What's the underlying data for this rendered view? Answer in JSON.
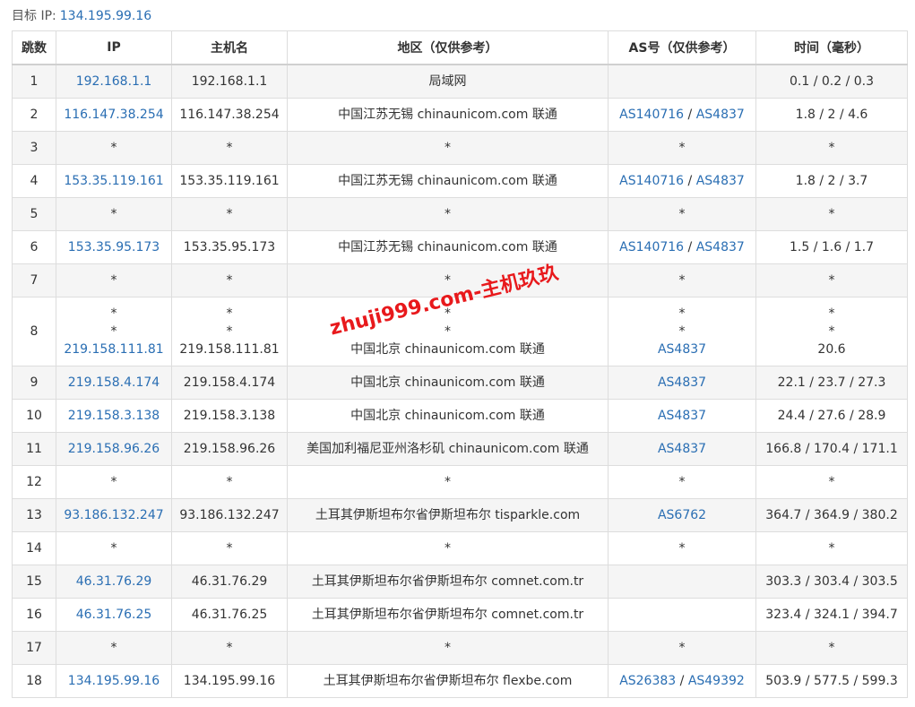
{
  "target": {
    "label": "目标 IP:",
    "ip": "134.195.99.16"
  },
  "columns": [
    "跳数",
    "IP",
    "主机名",
    "地区（仅供参考）",
    "AS号（仅供参考）",
    "时间（毫秒）"
  ],
  "hops": [
    {
      "hop": "1",
      "ip": [
        "192.168.1.1"
      ],
      "host": [
        "192.168.1.1"
      ],
      "region": [
        "局域网"
      ],
      "as": [
        []
      ],
      "time": [
        "0.1 / 0.2 / 0.3"
      ]
    },
    {
      "hop": "2",
      "ip": [
        "116.147.38.254"
      ],
      "host": [
        "116.147.38.254"
      ],
      "region": [
        "中国江苏无锡 chinaunicom.com 联通"
      ],
      "as": [
        [
          "AS140716",
          "AS4837"
        ]
      ],
      "time": [
        "1.8 / 2 / 4.6"
      ]
    },
    {
      "hop": "3",
      "ip": [
        "*"
      ],
      "host": [
        "*"
      ],
      "region": [
        "*"
      ],
      "as": [
        [
          "*"
        ]
      ],
      "time": [
        "*"
      ]
    },
    {
      "hop": "4",
      "ip": [
        "153.35.119.161"
      ],
      "host": [
        "153.35.119.161"
      ],
      "region": [
        "中国江苏无锡 chinaunicom.com 联通"
      ],
      "as": [
        [
          "AS140716",
          "AS4837"
        ]
      ],
      "time": [
        "1.8 / 2 / 3.7"
      ]
    },
    {
      "hop": "5",
      "ip": [
        "*"
      ],
      "host": [
        "*"
      ],
      "region": [
        "*"
      ],
      "as": [
        [
          "*"
        ]
      ],
      "time": [
        "*"
      ]
    },
    {
      "hop": "6",
      "ip": [
        "153.35.95.173"
      ],
      "host": [
        "153.35.95.173"
      ],
      "region": [
        "中国江苏无锡 chinaunicom.com 联通"
      ],
      "as": [
        [
          "AS140716",
          "AS4837"
        ]
      ],
      "time": [
        "1.5 / 1.6 / 1.7"
      ]
    },
    {
      "hop": "7",
      "ip": [
        "*"
      ],
      "host": [
        "*"
      ],
      "region": [
        "*"
      ],
      "as": [
        [
          "*"
        ]
      ],
      "time": [
        "*"
      ]
    },
    {
      "hop": "8",
      "ip": [
        "*",
        "*",
        "219.158.111.81"
      ],
      "host": [
        "*",
        "*",
        "219.158.111.81"
      ],
      "region": [
        "*",
        "*",
        "中国北京 chinaunicom.com 联通"
      ],
      "as": [
        [
          "*"
        ],
        [
          "*"
        ],
        [
          "AS4837"
        ]
      ],
      "time": [
        "*",
        "*",
        "20.6"
      ]
    },
    {
      "hop": "9",
      "ip": [
        "219.158.4.174"
      ],
      "host": [
        "219.158.4.174"
      ],
      "region": [
        "中国北京 chinaunicom.com 联通"
      ],
      "as": [
        [
          "AS4837"
        ]
      ],
      "time": [
        "22.1 / 23.7 / 27.3"
      ]
    },
    {
      "hop": "10",
      "ip": [
        "219.158.3.138"
      ],
      "host": [
        "219.158.3.138"
      ],
      "region": [
        "中国北京 chinaunicom.com 联通"
      ],
      "as": [
        [
          "AS4837"
        ]
      ],
      "time": [
        "24.4 / 27.6 / 28.9"
      ]
    },
    {
      "hop": "11",
      "ip": [
        "219.158.96.26"
      ],
      "host": [
        "219.158.96.26"
      ],
      "region": [
        "美国加利福尼亚州洛杉矶 chinaunicom.com 联通"
      ],
      "as": [
        [
          "AS4837"
        ]
      ],
      "time": [
        "166.8 / 170.4 / 171.1"
      ]
    },
    {
      "hop": "12",
      "ip": [
        "*"
      ],
      "host": [
        "*"
      ],
      "region": [
        "*"
      ],
      "as": [
        [
          "*"
        ]
      ],
      "time": [
        "*"
      ]
    },
    {
      "hop": "13",
      "ip": [
        "93.186.132.247"
      ],
      "host": [
        "93.186.132.247"
      ],
      "region": [
        "土耳其伊斯坦布尔省伊斯坦布尔 tisparkle.com"
      ],
      "as": [
        [
          "AS6762"
        ]
      ],
      "time": [
        "364.7 / 364.9 / 380.2"
      ]
    },
    {
      "hop": "14",
      "ip": [
        "*"
      ],
      "host": [
        "*"
      ],
      "region": [
        "*"
      ],
      "as": [
        [
          "*"
        ]
      ],
      "time": [
        "*"
      ]
    },
    {
      "hop": "15",
      "ip": [
        "46.31.76.29"
      ],
      "host": [
        "46.31.76.29"
      ],
      "region": [
        "土耳其伊斯坦布尔省伊斯坦布尔 comnet.com.tr"
      ],
      "as": [
        []
      ],
      "time": [
        "303.3 / 303.4 / 303.5"
      ]
    },
    {
      "hop": "16",
      "ip": [
        "46.31.76.25"
      ],
      "host": [
        "46.31.76.25"
      ],
      "region": [
        "土耳其伊斯坦布尔省伊斯坦布尔 comnet.com.tr"
      ],
      "as": [
        []
      ],
      "time": [
        "323.4 / 324.1 / 394.7"
      ]
    },
    {
      "hop": "17",
      "ip": [
        "*"
      ],
      "host": [
        "*"
      ],
      "region": [
        "*"
      ],
      "as": [
        [
          "*"
        ]
      ],
      "time": [
        "*"
      ]
    },
    {
      "hop": "18",
      "ip": [
        "134.195.99.16"
      ],
      "host": [
        "134.195.99.16"
      ],
      "region": [
        "土耳其伊斯坦布尔省伊斯坦布尔 flexbe.com"
      ],
      "as": [
        [
          "AS26383",
          "AS49392"
        ]
      ],
      "time": [
        "503.9 / 577.5 / 599.3"
      ]
    }
  ],
  "watermark": "zhuji999.com-主机玖玖",
  "colors": {
    "link": "#2a6eb3",
    "alt_row": "#f5f5f5",
    "border": "#dddddd",
    "watermark": "#e8191c"
  }
}
